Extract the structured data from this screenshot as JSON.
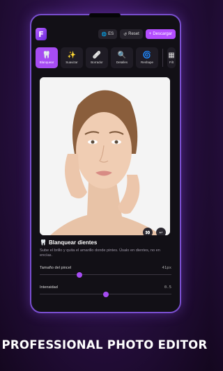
{
  "app": {
    "logo_letter": "F"
  },
  "topbar": {
    "language": "ES",
    "reset_label": "Reset",
    "download_label": "Descargar"
  },
  "tools": [
    {
      "label": "Blanquear",
      "icon": "tooth-icon",
      "active": true
    },
    {
      "label": "Suavizar",
      "icon": "sparkles-icon",
      "active": false
    },
    {
      "label": "Borrador",
      "icon": "eraser-icon",
      "active": false
    },
    {
      "label": "Detalles",
      "icon": "magnifier-icon",
      "active": false
    },
    {
      "label": "Reshape",
      "icon": "swirl-icon",
      "active": false
    },
    {
      "label": "Filt",
      "icon": "filter-icon",
      "active": false
    }
  ],
  "panel": {
    "title": "Blanquear dientes",
    "description": "Sube el brillo y quita el amarillo donde pintes. Úsalo en dientes, no en encías.",
    "brush_label": "Tamaño del pincel",
    "brush_value": "41px",
    "brush_fraction": 0.3,
    "intensity_label": "Intensidad",
    "intensity_value": "0.5",
    "intensity_fraction": 0.5
  },
  "headline": "PROFESSIONAL PHOTO EDITOR",
  "colors": {
    "accent": "#a64cf2",
    "frame": "#7a4fd0"
  }
}
